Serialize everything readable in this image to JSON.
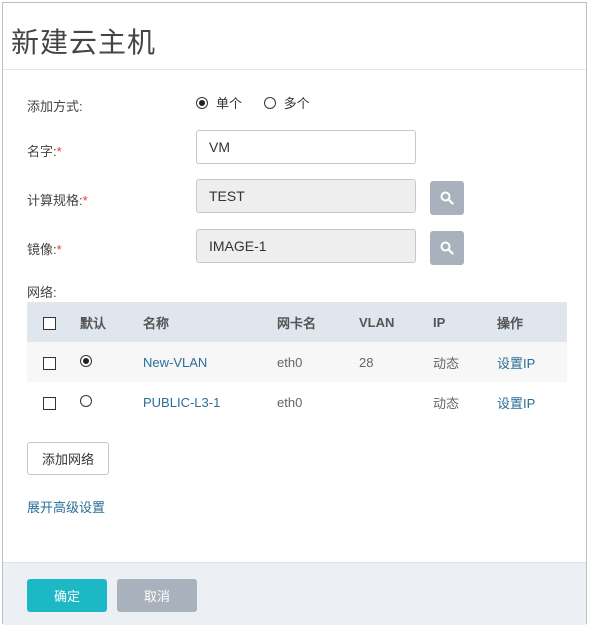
{
  "dialog": {
    "title": "新建云主机"
  },
  "form": {
    "add_mode": {
      "label": "添加方式:",
      "options": [
        "单个",
        "多个"
      ],
      "selected": "单个"
    },
    "name": {
      "label": "名字:",
      "required": "*",
      "value": "VM"
    },
    "spec": {
      "label": "计算规格:",
      "required": "*",
      "value": "TEST"
    },
    "image": {
      "label": "镜像:",
      "required": "*",
      "value": "IMAGE-1"
    },
    "network_label": "网络:"
  },
  "network_table": {
    "headers": [
      "默认",
      "名称",
      "网卡名",
      "VLAN",
      "IP",
      "操作"
    ],
    "rows": [
      {
        "default": true,
        "name": "New-VLAN",
        "nic": "eth0",
        "vlan": "28",
        "ip": "动态",
        "action": "设置IP"
      },
      {
        "default": false,
        "name": "PUBLIC-L3-1",
        "nic": "eth0",
        "vlan": "",
        "ip": "动态",
        "action": "设置IP"
      }
    ]
  },
  "add_network_label": "添加网络",
  "advanced_link": "展开高级设置",
  "footer": {
    "ok_label": "确定",
    "cancel_label": "取消"
  },
  "colors": {
    "primary": "#1cb8c6",
    "secondary": "#a9b2bc",
    "link": "#2a6f97",
    "required": "#e53935"
  },
  "icons": {
    "search": "search-icon"
  }
}
